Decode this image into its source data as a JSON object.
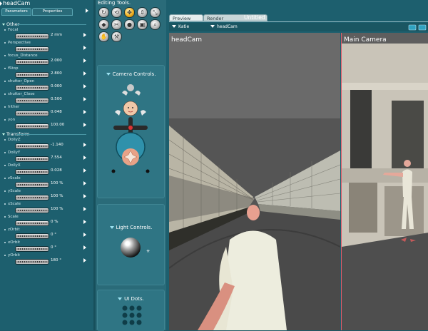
{
  "panel": {
    "title": "headCam",
    "tabs": [
      "Parameters",
      "Properties"
    ],
    "groups": {
      "other": "Other",
      "transform": "Transform"
    },
    "other_params": [
      {
        "label": "Focal",
        "value": "2 mm"
      },
      {
        "label": "Perspective",
        "value": ""
      },
      {
        "label": "focus_Distance",
        "value": "2.000"
      },
      {
        "label": "fStop",
        "value": "2.800"
      },
      {
        "label": "shutter_Open",
        "value": "0.000"
      },
      {
        "label": "shutter_Close",
        "value": "0.500"
      },
      {
        "label": "hither",
        "value": "0.048"
      },
      {
        "label": "yon",
        "value": "100.00"
      }
    ],
    "transform_params": [
      {
        "label": "DollyZ",
        "value": "-1.140"
      },
      {
        "label": "DollyY",
        "value": "7.554"
      },
      {
        "label": "DollyX",
        "value": "0.028"
      },
      {
        "label": "zScale",
        "value": "100 %"
      },
      {
        "label": "yScale",
        "value": "100 %"
      },
      {
        "label": "xScale",
        "value": "100 %"
      },
      {
        "label": "Scale",
        "value": "0 %"
      },
      {
        "label": "zOrbit",
        "value": "0 °"
      },
      {
        "label": "xOrbit",
        "value": "0 °"
      },
      {
        "label": "yOrbit",
        "value": "180 °"
      }
    ]
  },
  "tools": {
    "title": "Editing Tools.",
    "camera_title": "Camera Controls.",
    "light_title": "Light Controls.",
    "uidots_title": "UI Dots."
  },
  "viewport": {
    "tabs": [
      "Preview",
      "Render"
    ],
    "doc_title": "Untitled",
    "figure_select": "Katie",
    "camera_select": "headCam",
    "left_label": "headCam",
    "right_label": "Main Camera"
  },
  "colors": {
    "panel_bg": "#1d5f6e",
    "accent": "#f0b020",
    "viewport_divider": "#e25b6a"
  }
}
